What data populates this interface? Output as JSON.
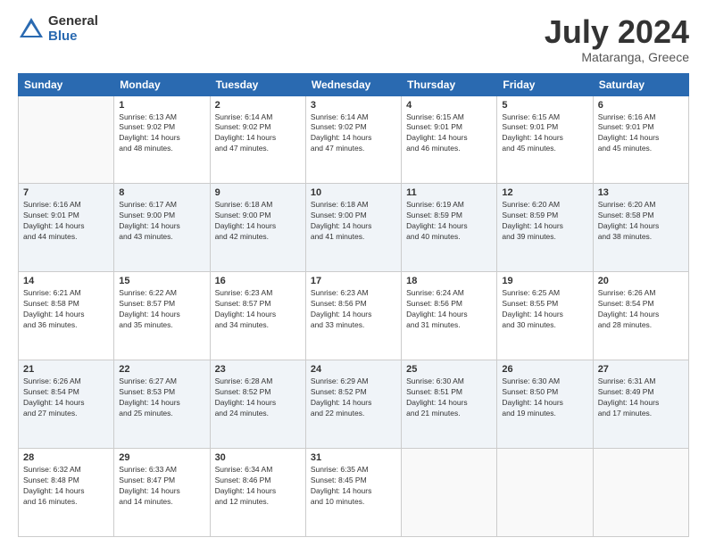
{
  "header": {
    "logo_general": "General",
    "logo_blue": "Blue",
    "month_title": "July 2024",
    "location": "Mataranga, Greece"
  },
  "days_of_week": [
    "Sunday",
    "Monday",
    "Tuesday",
    "Wednesday",
    "Thursday",
    "Friday",
    "Saturday"
  ],
  "weeks": [
    [
      {
        "day": "",
        "info": ""
      },
      {
        "day": "1",
        "info": "Sunrise: 6:13 AM\nSunset: 9:02 PM\nDaylight: 14 hours\nand 48 minutes."
      },
      {
        "day": "2",
        "info": "Sunrise: 6:14 AM\nSunset: 9:02 PM\nDaylight: 14 hours\nand 47 minutes."
      },
      {
        "day": "3",
        "info": "Sunrise: 6:14 AM\nSunset: 9:02 PM\nDaylight: 14 hours\nand 47 minutes."
      },
      {
        "day": "4",
        "info": "Sunrise: 6:15 AM\nSunset: 9:01 PM\nDaylight: 14 hours\nand 46 minutes."
      },
      {
        "day": "5",
        "info": "Sunrise: 6:15 AM\nSunset: 9:01 PM\nDaylight: 14 hours\nand 45 minutes."
      },
      {
        "day": "6",
        "info": "Sunrise: 6:16 AM\nSunset: 9:01 PM\nDaylight: 14 hours\nand 45 minutes."
      }
    ],
    [
      {
        "day": "7",
        "info": "Sunrise: 6:16 AM\nSunset: 9:01 PM\nDaylight: 14 hours\nand 44 minutes."
      },
      {
        "day": "8",
        "info": "Sunrise: 6:17 AM\nSunset: 9:00 PM\nDaylight: 14 hours\nand 43 minutes."
      },
      {
        "day": "9",
        "info": "Sunrise: 6:18 AM\nSunset: 9:00 PM\nDaylight: 14 hours\nand 42 minutes."
      },
      {
        "day": "10",
        "info": "Sunrise: 6:18 AM\nSunset: 9:00 PM\nDaylight: 14 hours\nand 41 minutes."
      },
      {
        "day": "11",
        "info": "Sunrise: 6:19 AM\nSunset: 8:59 PM\nDaylight: 14 hours\nand 40 minutes."
      },
      {
        "day": "12",
        "info": "Sunrise: 6:20 AM\nSunset: 8:59 PM\nDaylight: 14 hours\nand 39 minutes."
      },
      {
        "day": "13",
        "info": "Sunrise: 6:20 AM\nSunset: 8:58 PM\nDaylight: 14 hours\nand 38 minutes."
      }
    ],
    [
      {
        "day": "14",
        "info": "Sunrise: 6:21 AM\nSunset: 8:58 PM\nDaylight: 14 hours\nand 36 minutes."
      },
      {
        "day": "15",
        "info": "Sunrise: 6:22 AM\nSunset: 8:57 PM\nDaylight: 14 hours\nand 35 minutes."
      },
      {
        "day": "16",
        "info": "Sunrise: 6:23 AM\nSunset: 8:57 PM\nDaylight: 14 hours\nand 34 minutes."
      },
      {
        "day": "17",
        "info": "Sunrise: 6:23 AM\nSunset: 8:56 PM\nDaylight: 14 hours\nand 33 minutes."
      },
      {
        "day": "18",
        "info": "Sunrise: 6:24 AM\nSunset: 8:56 PM\nDaylight: 14 hours\nand 31 minutes."
      },
      {
        "day": "19",
        "info": "Sunrise: 6:25 AM\nSunset: 8:55 PM\nDaylight: 14 hours\nand 30 minutes."
      },
      {
        "day": "20",
        "info": "Sunrise: 6:26 AM\nSunset: 8:54 PM\nDaylight: 14 hours\nand 28 minutes."
      }
    ],
    [
      {
        "day": "21",
        "info": "Sunrise: 6:26 AM\nSunset: 8:54 PM\nDaylight: 14 hours\nand 27 minutes."
      },
      {
        "day": "22",
        "info": "Sunrise: 6:27 AM\nSunset: 8:53 PM\nDaylight: 14 hours\nand 25 minutes."
      },
      {
        "day": "23",
        "info": "Sunrise: 6:28 AM\nSunset: 8:52 PM\nDaylight: 14 hours\nand 24 minutes."
      },
      {
        "day": "24",
        "info": "Sunrise: 6:29 AM\nSunset: 8:52 PM\nDaylight: 14 hours\nand 22 minutes."
      },
      {
        "day": "25",
        "info": "Sunrise: 6:30 AM\nSunset: 8:51 PM\nDaylight: 14 hours\nand 21 minutes."
      },
      {
        "day": "26",
        "info": "Sunrise: 6:30 AM\nSunset: 8:50 PM\nDaylight: 14 hours\nand 19 minutes."
      },
      {
        "day": "27",
        "info": "Sunrise: 6:31 AM\nSunset: 8:49 PM\nDaylight: 14 hours\nand 17 minutes."
      }
    ],
    [
      {
        "day": "28",
        "info": "Sunrise: 6:32 AM\nSunset: 8:48 PM\nDaylight: 14 hours\nand 16 minutes."
      },
      {
        "day": "29",
        "info": "Sunrise: 6:33 AM\nSunset: 8:47 PM\nDaylight: 14 hours\nand 14 minutes."
      },
      {
        "day": "30",
        "info": "Sunrise: 6:34 AM\nSunset: 8:46 PM\nDaylight: 14 hours\nand 12 minutes."
      },
      {
        "day": "31",
        "info": "Sunrise: 6:35 AM\nSunset: 8:45 PM\nDaylight: 14 hours\nand 10 minutes."
      },
      {
        "day": "",
        "info": ""
      },
      {
        "day": "",
        "info": ""
      },
      {
        "day": "",
        "info": ""
      }
    ]
  ]
}
